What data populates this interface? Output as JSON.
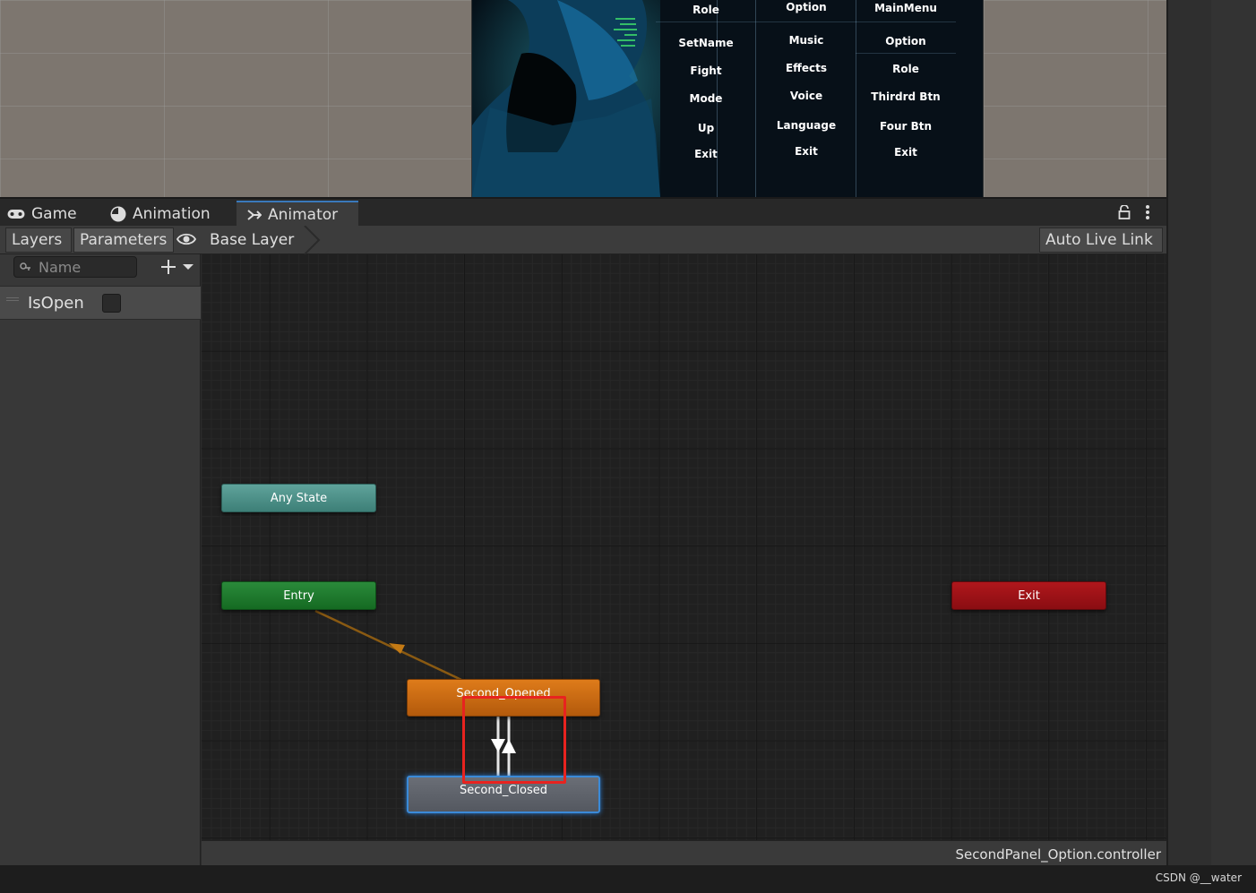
{
  "scene": {
    "menus": [
      {
        "items": [
          "Role",
          "SetName",
          "Fight",
          "Mode",
          "Up",
          "Exit"
        ]
      },
      {
        "items": [
          "Option",
          "Music",
          "Effects",
          "Voice",
          "Language",
          "Exit"
        ]
      },
      {
        "items": [
          "MainMenu",
          "Option",
          "Role",
          "Thirdrd Btn",
          "Four Btn",
          "Exit"
        ]
      }
    ]
  },
  "tabs": [
    {
      "label": "Game",
      "icon": "gamepad-icon"
    },
    {
      "label": "Animation",
      "icon": "clock-icon"
    },
    {
      "label": "Animator",
      "icon": "animator-icon",
      "active": true
    }
  ],
  "toolbar": {
    "layers_label": "Layers",
    "parameters_label": "Parameters",
    "breadcrumb": "Base Layer",
    "auto_live_link_label": "Auto Live Link"
  },
  "parameters": {
    "search_placeholder": "Name",
    "items": [
      {
        "name": "IsOpen",
        "type": "bool",
        "value": false
      }
    ]
  },
  "graph": {
    "nodes": {
      "any_state": "Any State",
      "entry": "Entry",
      "exit": "Exit",
      "second_opened": "Second_Opened",
      "second_closed": "Second_Closed"
    },
    "colors": {
      "any_state": "#4e918a",
      "entry": "#1f7a2e",
      "exit": "#9e1117",
      "default_state": "#c96a12",
      "selected_state": "#5f636b",
      "highlight": "#e8231f"
    }
  },
  "footer": {
    "controller": "SecondPanel_Option.controller",
    "watermark": "CSDN @__water"
  }
}
